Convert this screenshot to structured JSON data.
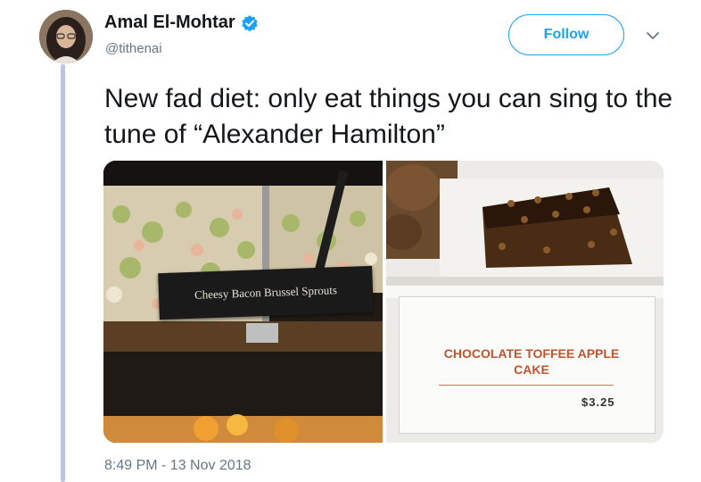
{
  "author": {
    "display_name": "Amal El-Mohtar",
    "handle": "@tithenai",
    "verified": true,
    "avatar_icon": "avatar-photo"
  },
  "actions": {
    "follow_label": "Follow",
    "more_icon": "chevron-down-icon"
  },
  "tweet": {
    "text": "New fad diet: only eat things you can sing to the tune of “Alexander Hamilton”",
    "timestamp": "8:49 PM - 13 Nov 2018"
  },
  "media": {
    "left_sign": "Cheesy Bacon Brussel Sprouts",
    "right_sign_product": "CHOCOLATE TOFFEE APPLE CAKE",
    "right_sign_price": "$3.25"
  },
  "colors": {
    "brand_blue": "#1da1f2",
    "thread_line": "#bcc3e3",
    "secondary_text": "#657786"
  }
}
